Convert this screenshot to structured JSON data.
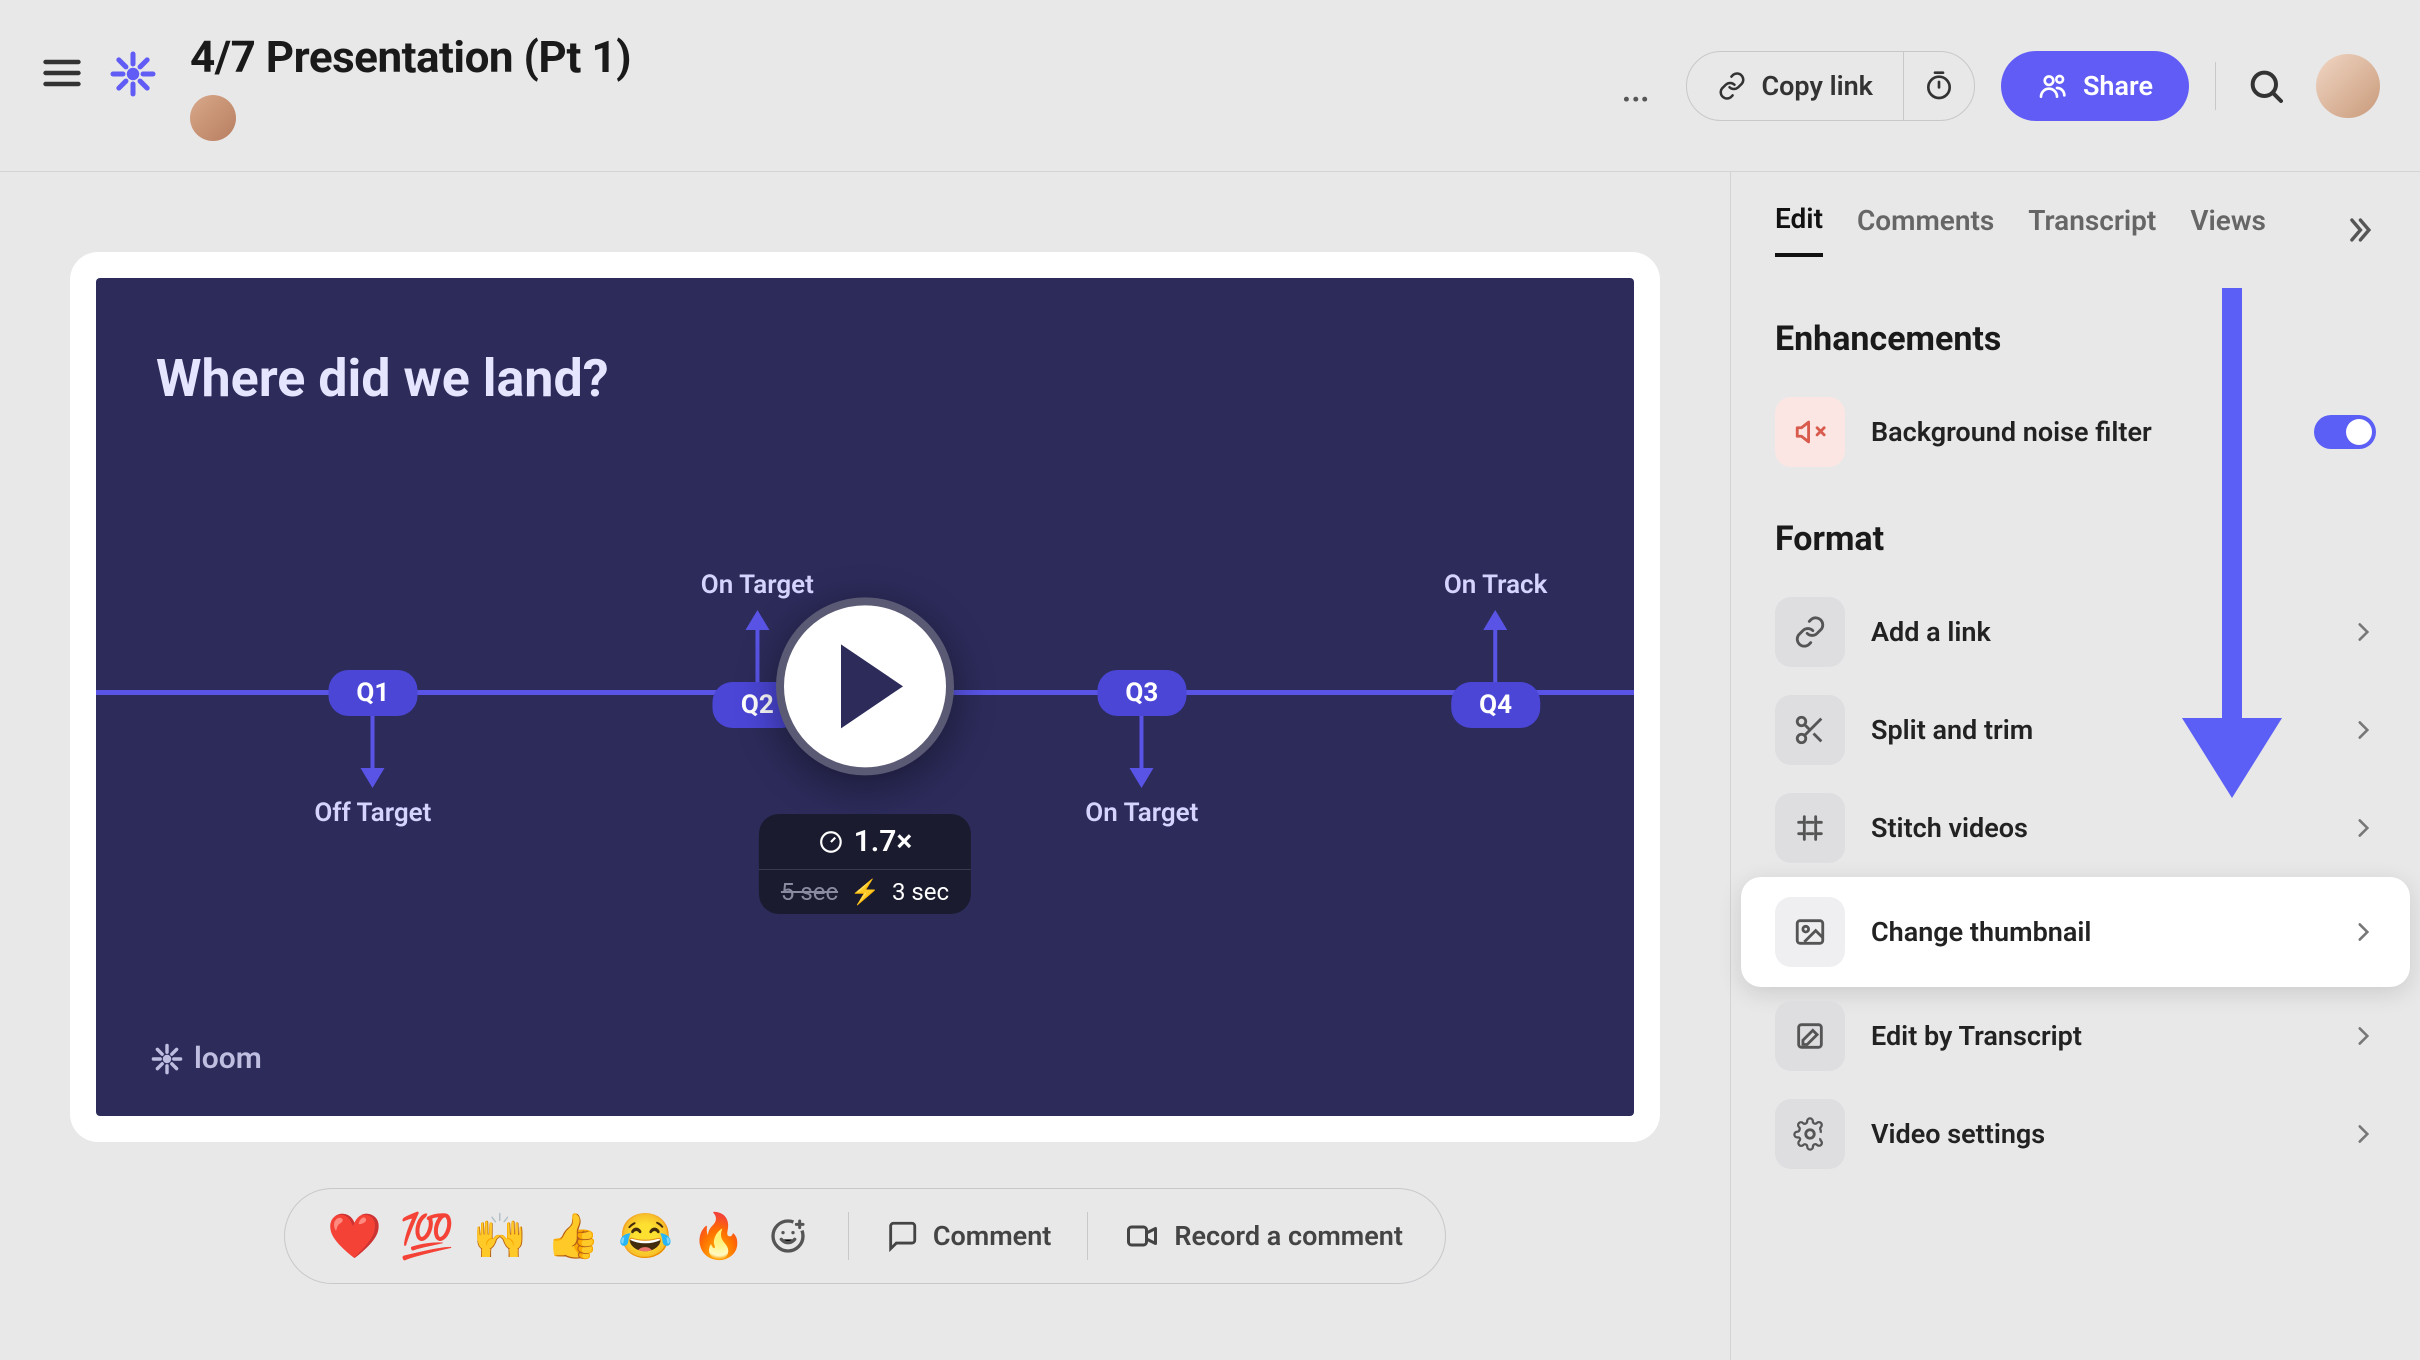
{
  "header": {
    "title": "4/7 Presentation (Pt 1)",
    "copy_link": "Copy link",
    "share": "Share"
  },
  "video": {
    "slide_title": "Where did we land?",
    "timeline": [
      {
        "chip": "Q1",
        "label": "Off Target",
        "dir": "down",
        "pos": 18
      },
      {
        "chip": "Q2",
        "label": "On Target",
        "dir": "up",
        "pos": 43
      },
      {
        "chip": "Q3",
        "label": "On Target",
        "dir": "down",
        "pos": 68
      },
      {
        "chip": "Q4",
        "label": "On Track",
        "dir": "up",
        "pos": 91
      }
    ],
    "speed": {
      "rate": "1.7×",
      "old_dur": "5 sec",
      "new_dur": "3 sec"
    },
    "watermark": "loom"
  },
  "reactions": {
    "emojis": [
      "❤️",
      "💯",
      "🙌",
      "👍",
      "😂",
      "🔥"
    ],
    "comment": "Comment",
    "record": "Record a comment"
  },
  "sidebar": {
    "tabs": [
      "Edit",
      "Comments",
      "Transcript",
      "Views"
    ],
    "active_tab": 0,
    "enhancements": {
      "title": "Enhancements",
      "noise": "Background noise filter",
      "noise_on": true
    },
    "format": {
      "title": "Format",
      "items": [
        {
          "label": "Add a link",
          "icon": "link"
        },
        {
          "label": "Split and trim",
          "icon": "scissors"
        },
        {
          "label": "Stitch videos",
          "icon": "stitch"
        },
        {
          "label": "Change thumbnail",
          "icon": "image",
          "highlight": true
        },
        {
          "label": "Edit by Transcript",
          "icon": "edit"
        },
        {
          "label": "Video settings",
          "icon": "gear"
        }
      ]
    }
  }
}
